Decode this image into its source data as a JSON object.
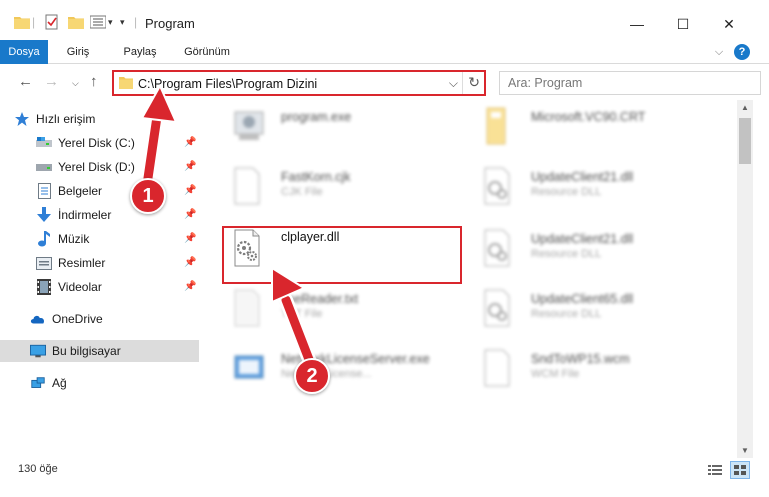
{
  "window": {
    "title": "Program",
    "minimize": "—",
    "maximize": "☐",
    "close": "✕"
  },
  "ribbon": {
    "tabs": [
      "Dosya",
      "Giriş",
      "Paylaş",
      "Görünüm"
    ],
    "help": "?",
    "expand": "⌵"
  },
  "address": {
    "path": "C:\\Program Files\\Program Dizini",
    "refresh": "↻",
    "dropdown": "⌵",
    "search_placeholder": "Ara: Program",
    "back": "←",
    "forward": "→",
    "recent": "⌵",
    "up": "↑"
  },
  "sidebar": {
    "quick_access": "Hızlı erişim",
    "items": [
      {
        "label": "Yerel Disk (C:)",
        "icon": "drive-icon"
      },
      {
        "label": "Yerel Disk (D:)",
        "icon": "drive-icon"
      },
      {
        "label": "Belgeler",
        "icon": "documents-icon"
      },
      {
        "label": "İndirmeler",
        "icon": "download-icon"
      },
      {
        "label": "Müzik",
        "icon": "music-icon"
      },
      {
        "label": "Resimler",
        "icon": "pictures-icon"
      },
      {
        "label": "Videolar",
        "icon": "videos-icon"
      }
    ],
    "onedrive": "OneDrive",
    "this_pc": "Bu bilgisayar",
    "network": "Ağ"
  },
  "files": [
    {
      "name": "program.exe",
      "type": "",
      "col": 0,
      "row": 0
    },
    {
      "name": "Microsoft.VC90.CRT",
      "type": "",
      "col": 1,
      "row": 0
    },
    {
      "name": "FastKorn.cjk",
      "type": "CJK File",
      "col": 0,
      "row": 1
    },
    {
      "name": "UpdateClient21.dll",
      "type": "Resource DLL",
      "col": 1,
      "row": 1
    },
    {
      "name": "clplayer.dll",
      "type": "",
      "col": 0,
      "row": 2
    },
    {
      "name": "UpdateClient21.dll",
      "type": "Resource DLL",
      "col": 1,
      "row": 2
    },
    {
      "name": "fineReader.txt",
      "type": "TXT File",
      "col": 0,
      "row": 3
    },
    {
      "name": "UpdateClient65.dll",
      "type": "Resource DLL",
      "col": 1,
      "row": 3
    },
    {
      "name": "NetworkLicenseServer.exe",
      "type": "Network License...",
      "col": 0,
      "row": 4
    },
    {
      "name": "SndToWP15.wcm",
      "type": "WCM File",
      "col": 1,
      "row": 4
    }
  ],
  "status": {
    "count": "130 öğe"
  },
  "annotations": {
    "step1": "1",
    "step2": "2"
  },
  "colors": {
    "accent": "#1979ca",
    "highlight": "#d9262d"
  }
}
